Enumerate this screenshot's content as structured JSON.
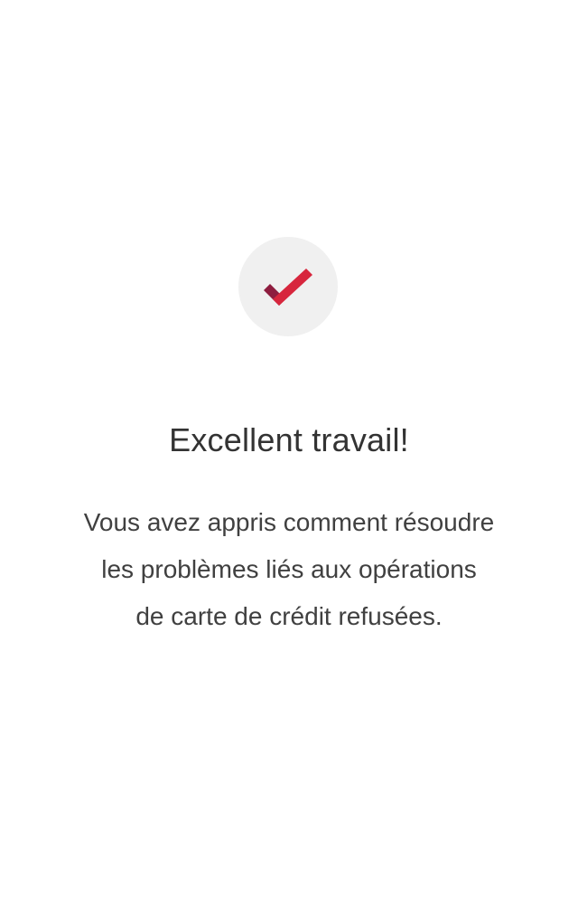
{
  "completion": {
    "icon": "checkmark-icon",
    "colors": {
      "badge_background": "#f0f0f0",
      "check_primary": "#d7263d",
      "check_shadow": "#8e1d3f"
    },
    "title": "Excellent travail!",
    "message_lines": [
      "Vous avez appris comment résoudre",
      "les problèmes liés aux opérations",
      "de carte de crédit refusées."
    ]
  }
}
